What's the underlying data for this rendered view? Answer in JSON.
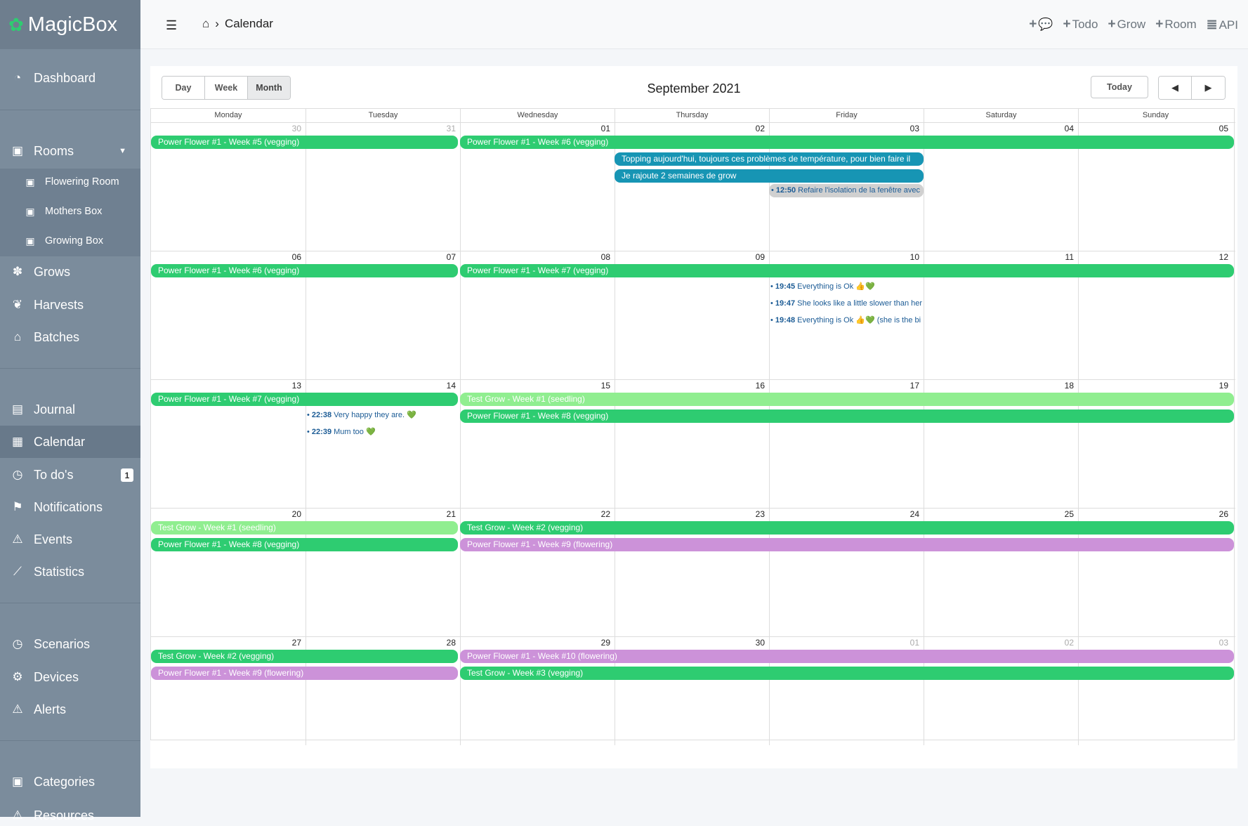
{
  "app": {
    "name": "MagicBox"
  },
  "sidebar": {
    "dashboard": "Dashboard",
    "rooms": "Rooms",
    "rooms_sub": [
      "Flowering Room",
      "Mothers Box",
      "Growing Box"
    ],
    "grows": "Grows",
    "harvests": "Harvests",
    "batches": "Batches",
    "journal": "Journal",
    "calendar": "Calendar",
    "todos": "To do's",
    "todos_badge": "1",
    "notifications": "Notifications",
    "events": "Events",
    "statistics": "Statistics",
    "scenarios": "Scenarios",
    "devices": "Devices",
    "alerts": "Alerts",
    "categories": "Categories",
    "resources": "Resources"
  },
  "topbar": {
    "breadcrumb": "Calendar",
    "todo": "Todo",
    "grow": "Grow",
    "room": "Room",
    "api": "API"
  },
  "calendar": {
    "views": [
      "Day",
      "Week",
      "Month"
    ],
    "selected_view": "Month",
    "title": "September 2021",
    "today_label": "Today",
    "days_of_week": [
      "Monday",
      "Tuesday",
      "Wednesday",
      "Thursday",
      "Friday",
      "Saturday",
      "Sunday"
    ],
    "weeks": [
      [
        "30",
        "31",
        "01",
        "02",
        "03",
        "04",
        "05"
      ],
      [
        "06",
        "07",
        "08",
        "09",
        "10",
        "11",
        "12"
      ],
      [
        "13",
        "14",
        "15",
        "16",
        "17",
        "18",
        "19"
      ],
      [
        "20",
        "21",
        "22",
        "23",
        "24",
        "25",
        "26"
      ],
      [
        "27",
        "28",
        "29",
        "30",
        "01",
        "02",
        "03"
      ]
    ],
    "events": {
      "w1_a": "Power Flower #1 - Week #5 (vegging)",
      "w1_b": "Power Flower #1 - Week #6 (vegging)",
      "w1_c": "Topping aujourd'hui, toujours ces problèmes de température, pour bien faire il",
      "w1_d": "Je rajoute 2 semaines de grow",
      "w1_e_time": "12:50",
      "w1_e_text": "Refaire l'isolation de la fenêtre avec",
      "w2_a": "Power Flower #1 - Week #6 (vegging)",
      "w2_b": "Power Flower #1 - Week #7 (vegging)",
      "w2_c_time": "19:45",
      "w2_c_text": "Everything is Ok 👍💚",
      "w2_d_time": "19:47",
      "w2_d_text": "She looks like a little slower than her",
      "w2_e_time": "19:48",
      "w2_e_text": "Everything is Ok 👍💚 (she is the bi",
      "w3_a": "Power Flower #1 - Week #7 (vegging)",
      "w3_b_time": "22:38",
      "w3_b_text": "Very happy they are. 💚",
      "w3_c_time": "22:39",
      "w3_c_text": "Mum too 💚",
      "w3_d": "Test Grow - Week #1 (seedling)",
      "w3_e": "Power Flower #1 - Week #8 (vegging)",
      "w4_a": "Test Grow - Week #1 (seedling)",
      "w4_b": "Power Flower #1 - Week #8 (vegging)",
      "w4_c": "Test Grow - Week #2 (vegging)",
      "w4_d": "Power Flower #1 - Week #9 (flowering)",
      "w5_a": "Test Grow - Week #2 (vegging)",
      "w5_b": "Power Flower #1 - Week #9 (flowering)",
      "w5_c": "Power Flower #1 - Week #10 (flowering)",
      "w5_d": "Test Grow - Week #3 (vegging)"
    }
  },
  "colors": {
    "vegging": "#2ecc71",
    "seedling": "#90ee90",
    "flowering": "#cc92d9",
    "journal": "#1795b4",
    "sidebar": "#7b8c9c"
  }
}
